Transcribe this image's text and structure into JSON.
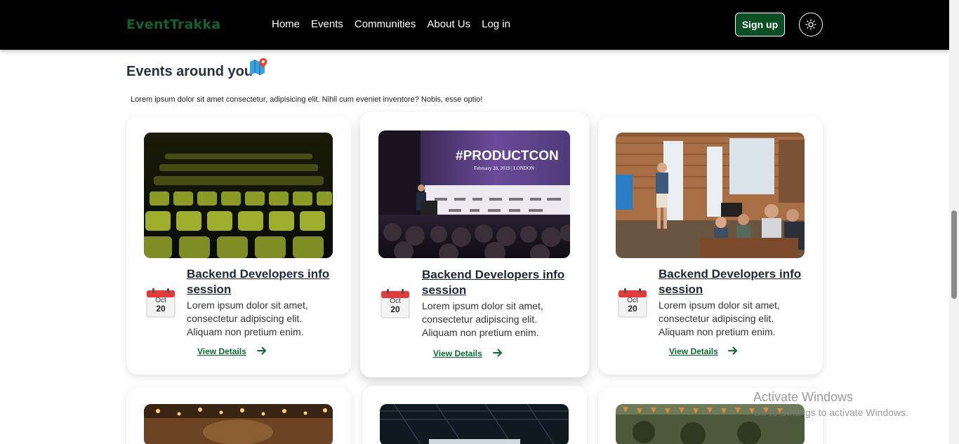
{
  "header": {
    "logo": "EventTrakka",
    "nav": [
      "Home",
      "Events",
      "Communities",
      "About Us",
      "Log in"
    ],
    "signup_label": "Sign up",
    "theme_icon": "sun-icon"
  },
  "section": {
    "title": "Events around you",
    "icon": "map-pin-icon",
    "subtitle": "Lorem ipsum dolor sit amet consectetur, adipisicing elit. Nihil cum eveniet inventore? Nobis, esse optio!"
  },
  "events": [
    {
      "image": "stadium-seats-photo",
      "month": "Oct",
      "day": "20",
      "title": "Backend Developers info session",
      "description": "Lorem ipsum dolor sit amet, consectetur adipiscing elit. Aliquam non pretium enim.",
      "cta": "View Details"
    },
    {
      "image": "productcon-stage-photo",
      "banner_text": "#PRODUCTCON",
      "banner_sub": "February 28, 2019 | LONDON",
      "month": "Oct",
      "day": "20",
      "title": "Backend Developers info session",
      "description": "Lorem ipsum dolor sit amet, consectetur adipiscing elit. Aliquam non pretium enim.",
      "cta": "View Details"
    },
    {
      "image": "office-talk-photo",
      "month": "Oct",
      "day": "20",
      "title": "Backend Developers info session",
      "description": "Lorem ipsum dolor sit amet, consectetur adipiscing elit. Aliquam non pretium enim.",
      "cta": "View Details"
    }
  ],
  "watermark": {
    "title": "Activate Windows",
    "subtitle": "Go to Settings to activate Windows."
  }
}
